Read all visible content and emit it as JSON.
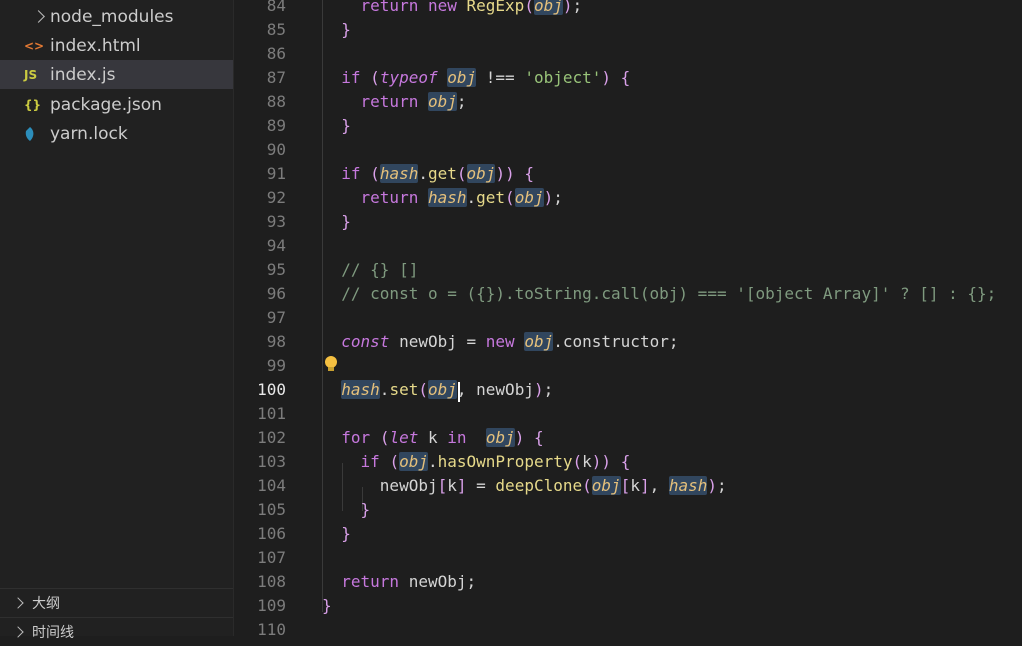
{
  "explorer": {
    "files": [
      {
        "icon_text": "",
        "icon": "chevron-right-icon",
        "label": "node_modules",
        "color": "#cccccc"
      },
      {
        "icon_text": "<>",
        "icon": "html-file-icon",
        "label": "index.html",
        "color": "#e37933"
      },
      {
        "icon_text": "JS",
        "icon": "js-file-icon",
        "label": "index.js",
        "color": "#cbcb41",
        "active": true
      },
      {
        "icon_text": "{}",
        "icon": "json-file-icon",
        "label": "package.json",
        "color": "#cbcb41"
      },
      {
        "icon_text": "",
        "icon": "yarn-file-icon",
        "label": "yarn.lock",
        "color": "#2c8ebb"
      }
    ]
  },
  "panels": {
    "outline": "大纲",
    "timeline": "时间线"
  },
  "editor": {
    "current_line": 100,
    "line_numbers": [
      "84",
      "85",
      "86",
      "87",
      "88",
      "89",
      "90",
      "91",
      "92",
      "93",
      "94",
      "95",
      "96",
      "97",
      "98",
      "99",
      "100",
      "101",
      "102",
      "103",
      "104",
      "105",
      "106",
      "107",
      "108",
      "109",
      "110"
    ],
    "lines": [
      "    return new RegExp(obj);",
      "  }",
      "",
      "  if (typeof obj !== 'object') {",
      "    return obj;",
      "  }",
      "",
      "  if (hash.get(obj)) {",
      "    return hash.get(obj);",
      "  }",
      "",
      "  // {} []",
      "  // const o = ({}).toString.call(obj) === '[object Array]' ? [] : {};",
      "",
      "  const newObj = new obj.constructor;",
      "",
      "  hash.set(obj, newObj);",
      "",
      "  for (let k in  obj) {",
      "    if (obj.hasOwnProperty(k)) {",
      "      newObj[k] = deepClone(obj[k], hash);",
      "    }",
      "  }",
      "",
      "  return newObj;",
      "}",
      ""
    ]
  }
}
